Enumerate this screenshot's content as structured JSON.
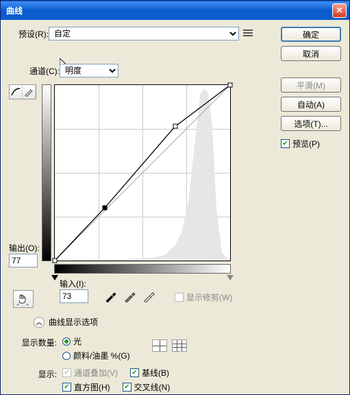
{
  "window": {
    "title": "曲线"
  },
  "preset": {
    "label": "预设(R):",
    "value": "自定"
  },
  "channel": {
    "label": "通道(C):",
    "value": "明度"
  },
  "output": {
    "label": "输出(O):",
    "value": "77"
  },
  "input": {
    "label": "输入(I):",
    "value": "73"
  },
  "show_clip": {
    "label": "显示修剪(W)"
  },
  "expander": {
    "label": "曲线显示选项"
  },
  "display_amount": {
    "label": "显示数量:",
    "light": "光",
    "pigment": "颜料/油墨 %(G)"
  },
  "show": {
    "label": "显示:",
    "channel_overlay": "通道叠加(V)",
    "baseline": "基线(B)",
    "histogram": "直方图(H)",
    "intersection": "交叉线(N)"
  },
  "buttons": {
    "ok": "确定",
    "cancel": "取消",
    "smooth": "平滑(M)",
    "auto": "自动(A)",
    "options": "选项(T)..."
  },
  "preview": {
    "label": "预览(P)"
  },
  "chart_data": {
    "type": "line",
    "title": "曲线",
    "xlabel": "输入",
    "ylabel": "输出",
    "xlim": [
      0,
      255
    ],
    "ylim": [
      0,
      255
    ],
    "series": [
      {
        "name": "curve",
        "x": [
          0,
          73,
          175,
          255
        ],
        "y": [
          0,
          77,
          195,
          255
        ]
      },
      {
        "name": "baseline",
        "x": [
          0,
          255
        ],
        "y": [
          0,
          255
        ]
      }
    ],
    "selected_point": {
      "x": 73,
      "y": 77
    },
    "histogram_peak_range": [
      180,
      230
    ]
  }
}
